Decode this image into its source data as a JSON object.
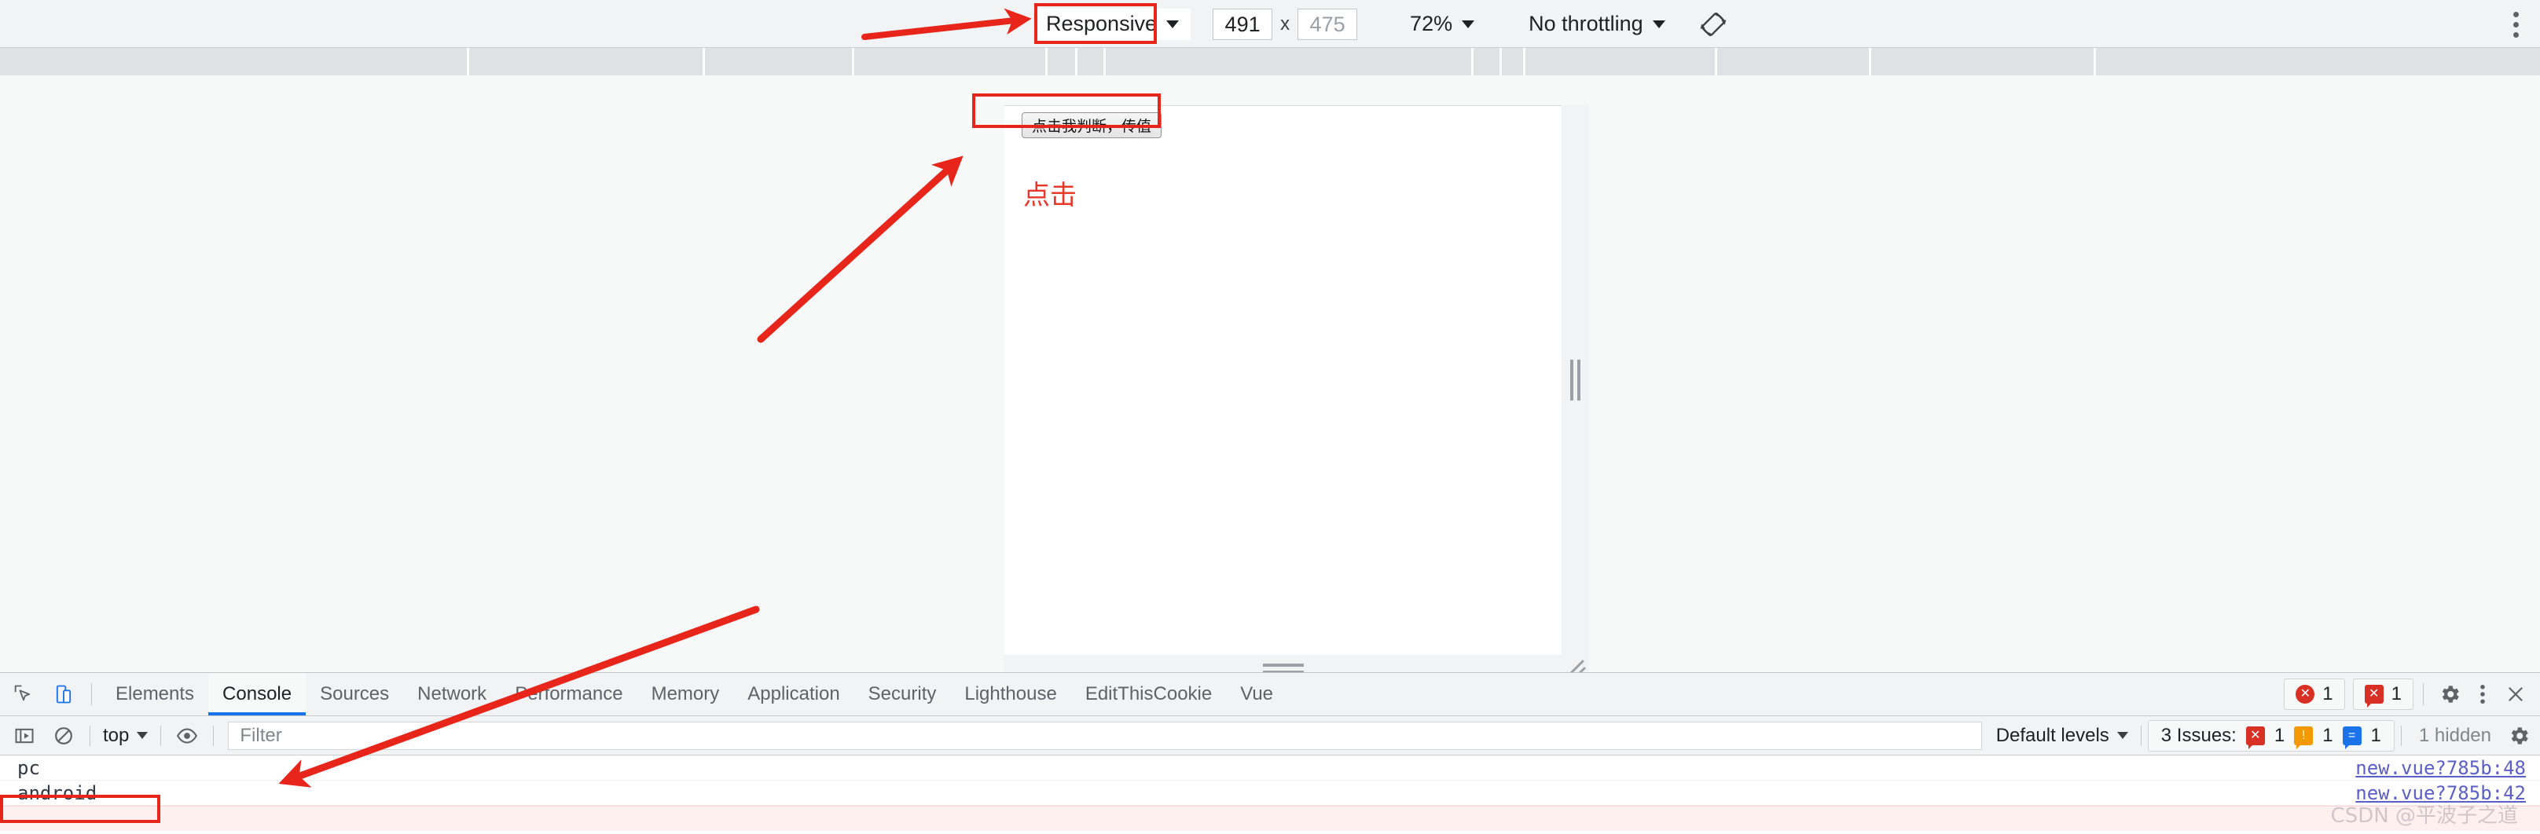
{
  "device_toolbar": {
    "device_select": "Responsive",
    "width_value": "491",
    "height_value": "475",
    "dimension_separator": "x",
    "zoom_value": "72%",
    "throttling": "No throttling",
    "rotate_icon": "rotate-device-icon",
    "more_icon": "three-dot-menu-icon"
  },
  "page": {
    "button_label": "点击我判断，传值",
    "red_text": "点击"
  },
  "devtools": {
    "tabs": [
      {
        "label": "Elements",
        "active": false
      },
      {
        "label": "Console",
        "active": true
      },
      {
        "label": "Sources",
        "active": false
      },
      {
        "label": "Network",
        "active": false
      },
      {
        "label": "Performance",
        "active": false
      },
      {
        "label": "Memory",
        "active": false
      },
      {
        "label": "Application",
        "active": false
      },
      {
        "label": "Security",
        "active": false
      },
      {
        "label": "Lighthouse",
        "active": false
      },
      {
        "label": "EditThisCookie",
        "active": false
      },
      {
        "label": "Vue",
        "active": false
      }
    ],
    "left_icons": [
      {
        "name": "inspect-element-icon"
      },
      {
        "name": "device-toolbar-toggle-icon"
      }
    ],
    "error_count": "1",
    "message_count": "1",
    "settings_icon": "gear-icon",
    "overflow_icon": "three-dot-menu-icon",
    "close_icon": "close-icon"
  },
  "console_toolbar": {
    "sidebar_toggle_icon": "console-sidebar-icon",
    "clear_icon": "clear-console-icon",
    "context_select": "top",
    "eye_icon": "live-expression-icon",
    "filter_placeholder": "Filter",
    "levels_select": "Default levels",
    "issues_label": "3 Issues:",
    "issues_error_count": "1",
    "issues_warning_count": "1",
    "issues_info_count": "1",
    "hidden_label": "1 hidden",
    "settings_icon": "gear-icon"
  },
  "console_logs": [
    {
      "text": "pc",
      "source": "new.vue?785b:48"
    },
    {
      "text": "android",
      "source": "new.vue?785b:42"
    }
  ],
  "watermark": "CSDN @平波子之道",
  "colors": {
    "annotation_red": "#e8251b",
    "accent_blue": "#1a73e8",
    "error_red": "#d93025",
    "warning_orange": "#f29900"
  }
}
